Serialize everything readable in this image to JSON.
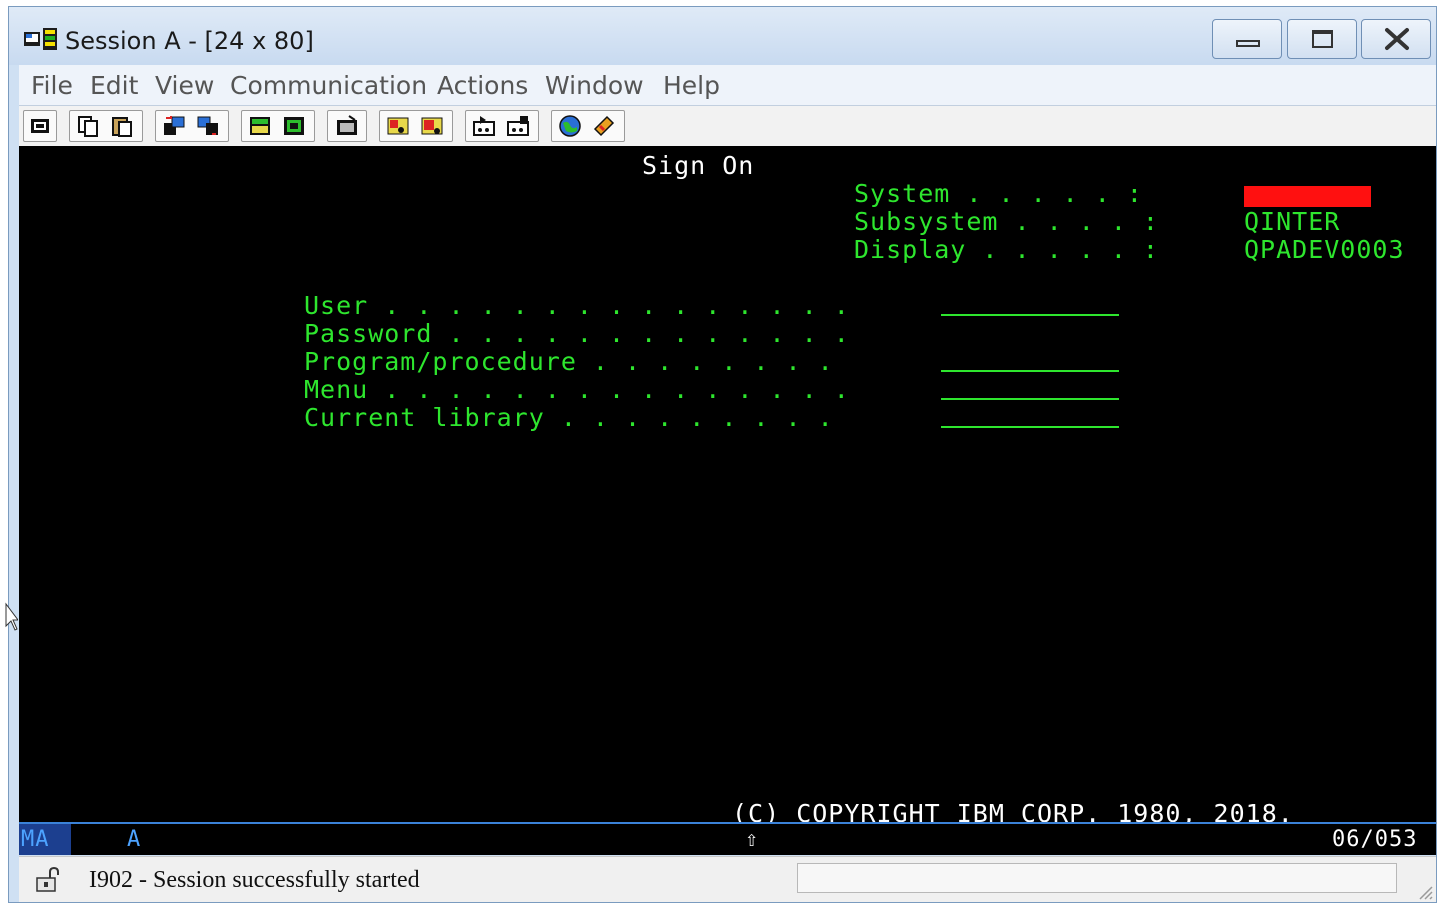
{
  "window": {
    "title": "Session A - [24 x 80]",
    "icon": "session-icon"
  },
  "menu": [
    "File",
    "Edit",
    "View",
    "Communication",
    "Actions",
    "Window",
    "Help"
  ],
  "toolbar": {
    "icons": [
      "print-screen-icon",
      "copy-icon",
      "paste-icon",
      "send-file-icon",
      "receive-file-icon",
      "display-keypad-icon",
      "display-setup-icon",
      "macro-icon",
      "record-macro-icon",
      "stop-macro-icon",
      "play-macro-icon",
      "transfer-icon",
      "web-icon",
      "help-icon"
    ]
  },
  "screen": {
    "title": "Sign On",
    "system_label": "System . . . . . :",
    "subsystem_label": "Subsystem . . . . :",
    "subsystem_value": "QINTER",
    "display_label": "Display . . . . . :",
    "display_value": "QPADEV0003",
    "fields": [
      {
        "label": "User . . . . . . . . . . . . . . ."
      },
      {
        "label": "Password . . . . . . . . . . . . ."
      },
      {
        "label": "Program/procedure . . . . . . . ."
      },
      {
        "label": "Menu . . . . . . . . . . . . . . ."
      },
      {
        "label": "Current library . . . . . . . . ."
      }
    ],
    "copyright": "(C) COPYRIGHT IBM CORP. 1980, 2018."
  },
  "oia": {
    "ma": "MA",
    "mode": "A",
    "shift_symbol": "⇧",
    "cursor_pos": "06/053"
  },
  "status": {
    "message": "I902 - Session successfully started"
  },
  "colors": {
    "terminal_green": "#2ee62e",
    "terminal_white": "#ffffff",
    "redaction": "#ff1010",
    "oia_border": "#3b82d8"
  }
}
